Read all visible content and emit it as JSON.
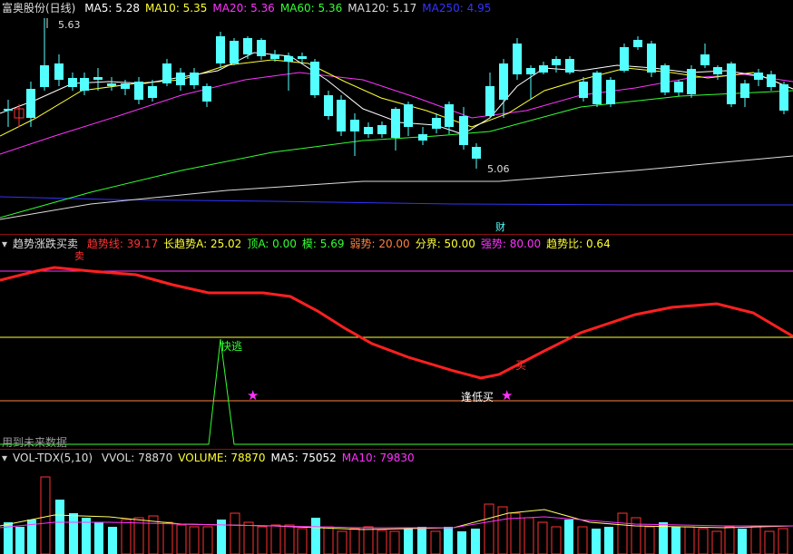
{
  "main": {
    "title": "富奥股份(日线)",
    "ma_labels": [
      {
        "text": "MA5: 5.28",
        "color": "#ffffff"
      },
      {
        "text": "MA10: 5.35",
        "color": "#ffff33"
      },
      {
        "text": "MA20: 5.36",
        "color": "#ff33ff"
      },
      {
        "text": "MA60: 5.36",
        "color": "#33ff33"
      },
      {
        "text": "MA120: 5.17",
        "color": "#dddddd"
      },
      {
        "text": "MA250: 4.95",
        "color": "#3333ff"
      }
    ],
    "high_label": "5.63",
    "low_label": "5.06",
    "finance_marker": "财"
  },
  "indicator": {
    "title": "趋势涨跌买卖",
    "labels": [
      {
        "text": "趋势线: 39.17",
        "color": "#ff3333"
      },
      {
        "text": "长趋势A: 25.02",
        "color": "#ffff33"
      },
      {
        "text": "顶A: 0.00",
        "color": "#33ff33"
      },
      {
        "text": "模: 5.69",
        "color": "#33ff33"
      },
      {
        "text": "弱势: 20.00",
        "color": "#ff8040"
      },
      {
        "text": "分界: 50.00",
        "color": "#ffff33"
      },
      {
        "text": "强势: 80.00",
        "color": "#ff33ff"
      },
      {
        "text": "趋势比: 0.64",
        "color": "#ffff33"
      }
    ],
    "sell_mark": "卖",
    "buy_mark": "买",
    "escape_label": "快逃",
    "dip_label": "逢低买",
    "future_data_note": "用到未来数据"
  },
  "volume": {
    "title": "VOL-TDX(5,10)",
    "labels": [
      {
        "text": "VVOL: 78870",
        "color": "#dddddd"
      },
      {
        "text": "VOLUME: 78870",
        "color": "#ffff33"
      },
      {
        "text": "MA5: 75052",
        "color": "#ffffff"
      },
      {
        "text": "MA10: 79830",
        "color": "#ff33ff"
      }
    ]
  },
  "colors": {
    "up": "#ff3232",
    "down": "#54ffff",
    "grid": "#8b1010"
  }
}
